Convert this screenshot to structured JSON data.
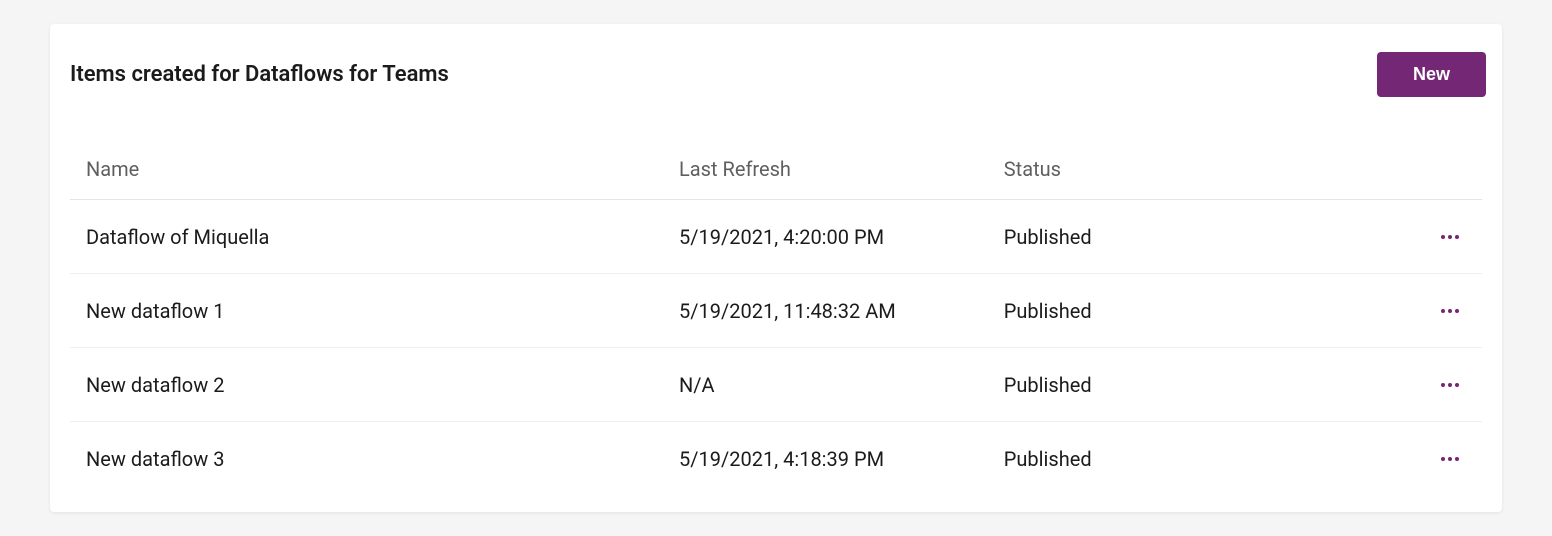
{
  "header": {
    "title": "Items created for Dataflows for Teams",
    "new_button_label": "New"
  },
  "table": {
    "columns": {
      "name": "Name",
      "last_refresh": "Last Refresh",
      "status": "Status"
    },
    "rows": [
      {
        "name": "Dataflow of Miquella",
        "last_refresh": "5/19/2021, 4:20:00 PM",
        "status": "Published"
      },
      {
        "name": "New dataflow 1",
        "last_refresh": "5/19/2021, 11:48:32 AM",
        "status": "Published"
      },
      {
        "name": "New dataflow 2",
        "last_refresh": "N/A",
        "status": "Published"
      },
      {
        "name": "New dataflow 3",
        "last_refresh": "5/19/2021, 4:18:39 PM",
        "status": "Published"
      }
    ]
  },
  "colors": {
    "accent": "#742774"
  }
}
